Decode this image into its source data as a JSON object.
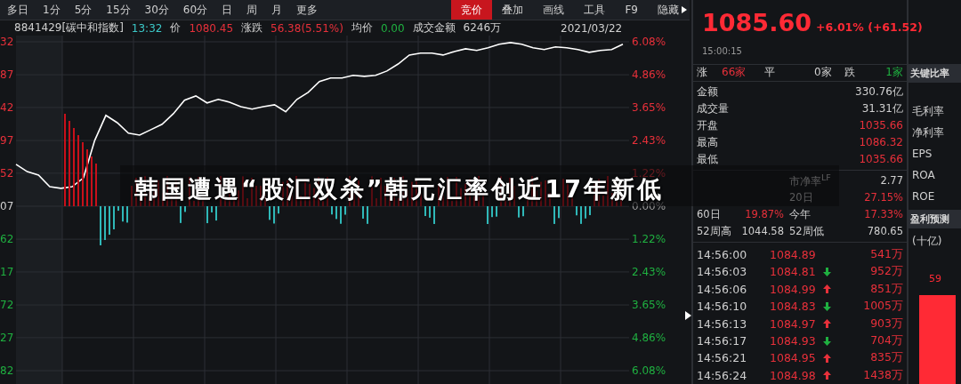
{
  "toolbar": {
    "periods": [
      {
        "label": "多日",
        "selected": false
      },
      {
        "label": "1分",
        "selected": false
      },
      {
        "label": "5分",
        "selected": false
      },
      {
        "label": "15分",
        "selected": false
      },
      {
        "label": "30分",
        "selected": false
      },
      {
        "label": "60分",
        "selected": false
      },
      {
        "label": "日",
        "selected": false
      },
      {
        "label": "周",
        "selected": false
      },
      {
        "label": "月",
        "selected": false
      },
      {
        "label": "更多",
        "selected": false
      }
    ],
    "tools": [
      {
        "label": "竞价",
        "selected": true
      },
      {
        "label": "叠加",
        "selected": false
      },
      {
        "label": "画线",
        "selected": false
      },
      {
        "label": "工具",
        "selected": false
      },
      {
        "label": "F9",
        "selected": false
      },
      {
        "label": "隐藏",
        "selected": false
      }
    ]
  },
  "info_line": [
    {
      "text": "8841429[碳中和指数]"
    },
    {
      "text": "13:32",
      "color": "#3cc8c8"
    },
    {
      "text": "价"
    },
    {
      "text": "1080.45",
      "color": "#e8303a"
    },
    {
      "text": "涨跌"
    },
    {
      "text": "56.38(5.51%)",
      "color": "#e8303a"
    },
    {
      "text": "均价"
    },
    {
      "text": "0.00",
      "color": "#1fb040"
    },
    {
      "text": "成交金额"
    },
    {
      "text": "6246万"
    }
  ],
  "date": "2021/03/22",
  "price_axis": [
    {
      "label": "32",
      "color": "#e8303a"
    },
    {
      "label": "87",
      "color": "#e8303a"
    },
    {
      "label": "42",
      "color": "#e8303a"
    },
    {
      "label": "97",
      "color": "#e8303a"
    },
    {
      "label": "52",
      "color": "#e8303a"
    },
    {
      "label": "07",
      "color": "#d0d0d0"
    },
    {
      "label": "62",
      "color": "#1fb040"
    },
    {
      "label": "17",
      "color": "#1fb040"
    },
    {
      "label": "72",
      "color": "#1fb040"
    },
    {
      "label": "27",
      "color": "#1fb040"
    },
    {
      "label": "82",
      "color": "#1fb040"
    }
  ],
  "chart_data": {
    "type": "line",
    "ylim": [
      -6.08,
      6.08
    ],
    "grid": true,
    "yticks": [
      {
        "value": 6.08,
        "label": "6.08%"
      },
      {
        "value": 4.86,
        "label": "4.86%"
      },
      {
        "value": 3.65,
        "label": "3.65%"
      },
      {
        "value": 2.43,
        "label": "2.43%"
      },
      {
        "value": 1.22,
        "label": "1.22%"
      },
      {
        "value": 0,
        "label": "0.00%"
      },
      {
        "value": -1.22,
        "label": "1.22%"
      },
      {
        "value": -2.43,
        "label": "2.43%"
      },
      {
        "value": -3.65,
        "label": "3.65%"
      },
      {
        "value": -4.86,
        "label": "4.86%"
      },
      {
        "value": -6.08,
        "label": "6.08%"
      }
    ],
    "series": [
      {
        "color": "#ffffff",
        "values": [
          1.55,
          1.28,
          1.15,
          0.72,
          0.66,
          0.72,
          1.05,
          2.43,
          3.36,
          3.09,
          2.7,
          2.63,
          2.83,
          3.03,
          3.42,
          3.92,
          4.08,
          3.82,
          3.95,
          3.85,
          3.68,
          3.59,
          3.68,
          3.75,
          3.49,
          3.95,
          4.21,
          4.61,
          4.74,
          4.74,
          4.84,
          4.8,
          4.84,
          5.0,
          5.26,
          5.59,
          5.66,
          5.66,
          5.59,
          5.72,
          5.82,
          5.76,
          5.86,
          5.99,
          6.05,
          5.99,
          5.86,
          5.79,
          5.89,
          5.86,
          5.79,
          5.69,
          5.76,
          5.79,
          5.99
        ]
      }
    ]
  },
  "headline": "韩国遭遇“股汇双杀”韩元汇率创近17年新低",
  "quote": {
    "price": "1085.60",
    "change": "+6.01% (+61.52)",
    "time": "15:00:15"
  },
  "breadth": [
    {
      "label": "涨",
      "count": "66家",
      "color": "#e8303a"
    },
    {
      "label": "平",
      "count": "0家",
      "color": "#d0d0d0"
    },
    {
      "label": "跌",
      "count": "1家",
      "color": "#1fb040"
    }
  ],
  "stats": [
    {
      "label": "金额",
      "value": "330.76亿",
      "color": "#d0d0d0"
    },
    {
      "label": "成交量",
      "value": "31.31亿",
      "color": "#d0d0d0"
    },
    {
      "label": "开盘",
      "value": "1035.66",
      "color": "#e8303a"
    },
    {
      "label": "最高",
      "value": "1086.32",
      "color": "#e8303a"
    },
    {
      "label": "最低",
      "value": "1035.66",
      "color": "#e8303a"
    }
  ],
  "ratios": [
    {
      "right": {
        "label": "市净率$^{LF}$",
        "value": "2.77",
        "color": "#d0d0d0"
      }
    },
    {
      "right": {
        "label": "20日",
        "value": "27.15%",
        "color": "#e8303a"
      }
    },
    {
      "left": {
        "label": "60日",
        "value": "19.87%",
        "color": "#e8303a"
      },
      "right": {
        "label": "今年",
        "value": "17.33%",
        "color": "#e8303a"
      }
    },
    {
      "left": {
        "label": "52周高",
        "value": "1044.58",
        "color": "#d0d0d0"
      },
      "right": {
        "label": "52周低",
        "value": "780.65",
        "color": "#d0d0d0"
      }
    }
  ],
  "ticks": [
    {
      "time": "14:56:00",
      "price": "1084.89",
      "kind": "none",
      "volume": "541万"
    },
    {
      "time": "14:56:03",
      "price": "1084.81",
      "kind": "down",
      "volume": "952万"
    },
    {
      "time": "14:56:06",
      "price": "1084.99",
      "kind": "up",
      "volume": "851万"
    },
    {
      "time": "14:56:10",
      "price": "1084.83",
      "kind": "down",
      "volume": "1005万"
    },
    {
      "time": "14:56:13",
      "price": "1084.97",
      "kind": "up",
      "volume": "903万"
    },
    {
      "time": "14:56:17",
      "price": "1084.93",
      "kind": "down",
      "volume": "704万"
    },
    {
      "time": "14:56:21",
      "price": "1084.95",
      "kind": "up",
      "volume": "835万"
    },
    {
      "time": "14:56:24",
      "price": "1084.98",
      "kind": "up",
      "volume": "1438万"
    }
  ],
  "key_ratios": {
    "title": "关键比率",
    "items": [
      "毛利率",
      "净利率",
      "EPS",
      "ROA",
      "ROE"
    ]
  },
  "forecast": {
    "title": "盈利预测",
    "unit": "(十亿)",
    "bar_label": "59"
  }
}
